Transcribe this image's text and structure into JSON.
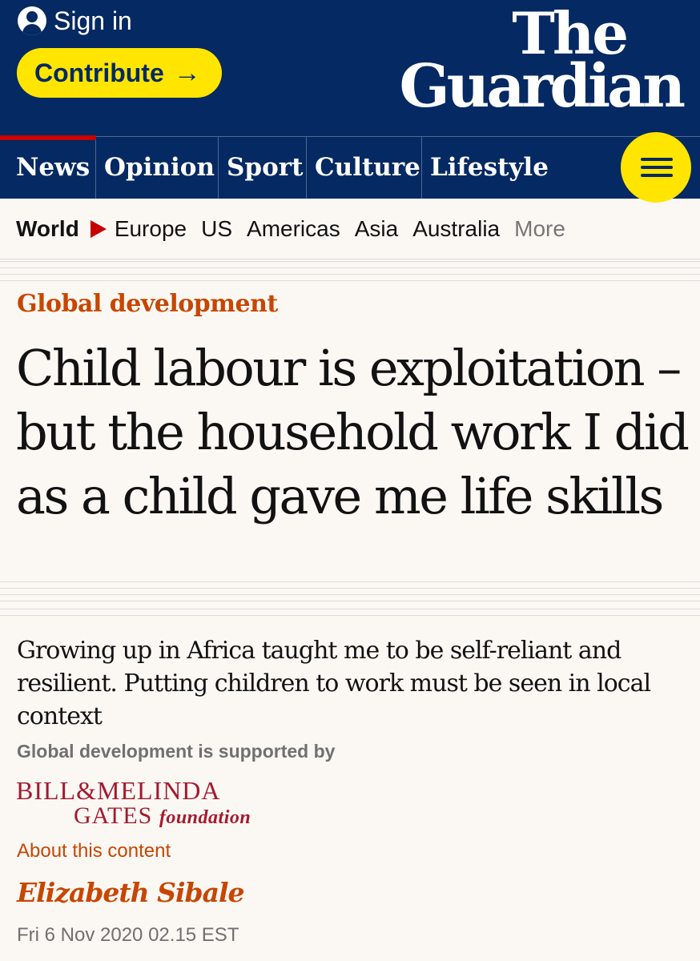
{
  "header": {
    "signin_label": "Sign in",
    "contribute_label": "Contribute",
    "contribute_arrow": "→",
    "logo_line1": "The",
    "logo_line2": "Guardian"
  },
  "nav": {
    "items": [
      "News",
      "Opinion",
      "Sport",
      "Culture",
      "Lifestyle"
    ],
    "active": "News"
  },
  "subnav": {
    "current": "World",
    "items": [
      "Europe",
      "US",
      "Americas",
      "Asia",
      "Australia"
    ],
    "more_label": "More"
  },
  "article": {
    "section": "Global development",
    "headline": "Child labour is exploitation – but the household work I did as a child gave me life skills",
    "standfirst": "Growing up in Africa taught me to be self-reliant and resilient. Putting children to work must be seen in local context",
    "supported_by": "Global development is supported by",
    "sponsor_line1": "BILL&MELINDA",
    "sponsor_line2": "GATES",
    "sponsor_line3": "foundation",
    "about_label": "About this content",
    "author": "Elizabeth Sibale",
    "date": "Fri 6 Nov 2020 02.15 EST"
  },
  "colors": {
    "brand_blue": "#052962",
    "highlight_yellow": "#ffe500",
    "news_red": "#c70000",
    "section_orange": "#c74600",
    "page_background": "#fbf8f4"
  },
  "icons": [
    "user-account-icon",
    "arrow-right-icon",
    "hamburger-menu-icon",
    "triangle-right-icon"
  ]
}
